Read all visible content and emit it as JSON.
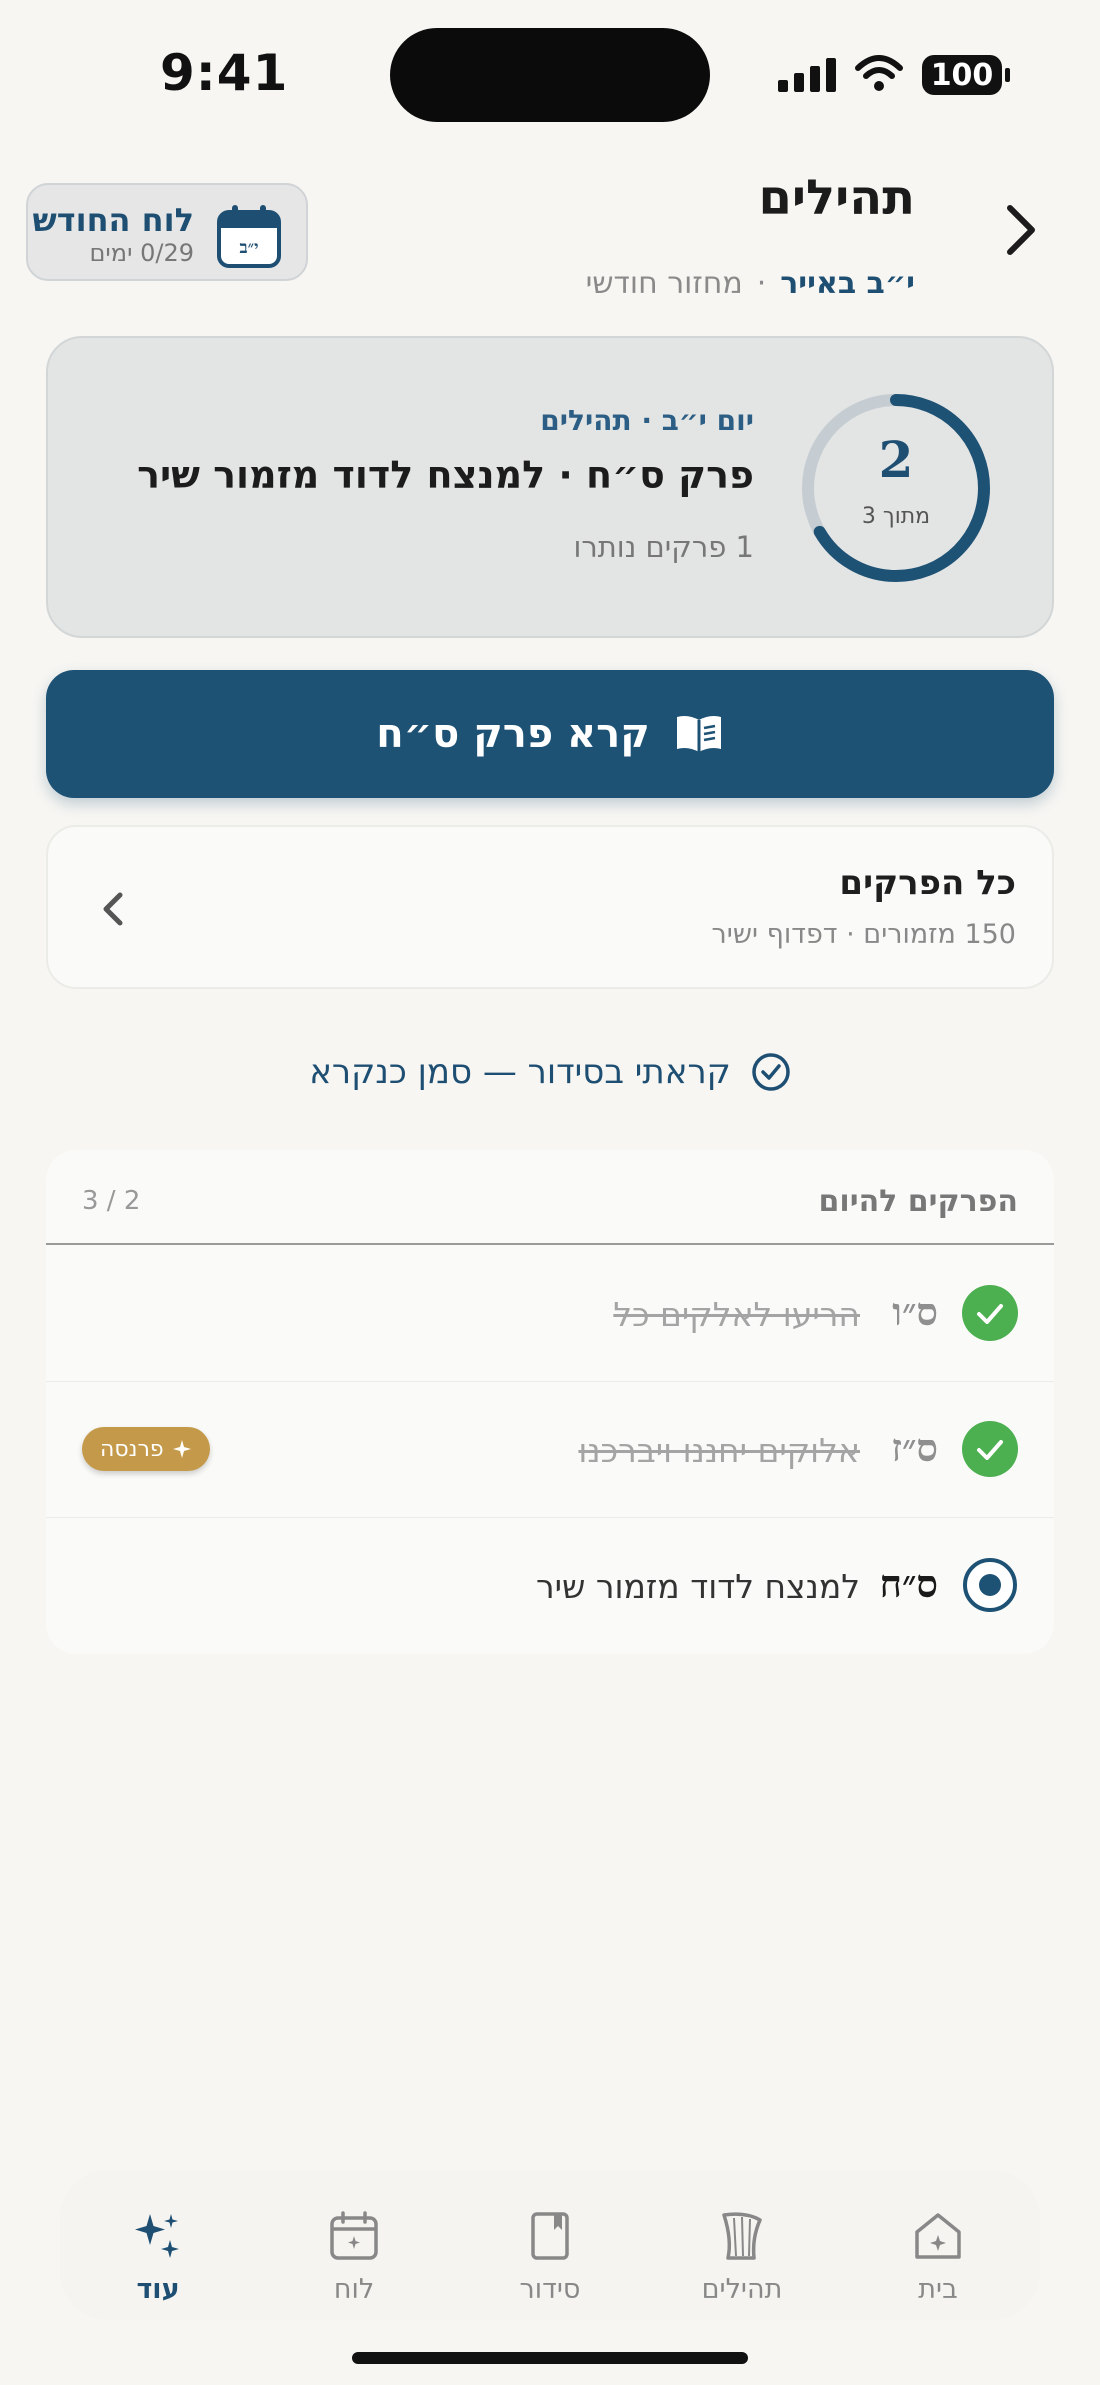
{
  "status": {
    "time": "9:41",
    "battery": "100"
  },
  "header": {
    "title": "תהילים",
    "date": "י״ב באייר",
    "separator": "·",
    "cycle": "מחזור חודשי"
  },
  "month_button": {
    "label": "לוח החודש",
    "days": "0/29 ימים",
    "calendar_badge": "י״ב"
  },
  "progress": {
    "current": "2",
    "of_label": "מתוך 3",
    "completed": 2,
    "total": 3,
    "eyebrow": "יום י״ב · תהילים",
    "title": "פרק ס״ח · למנצח לדוד מזמור שיר",
    "remaining": "1 פרקים נותרו"
  },
  "read_button": {
    "label": "קרא פרק ס״ח"
  },
  "all_chapters": {
    "title": "כל הפרקים",
    "subtitle": "150 מזמורים · דפדוף ישיר"
  },
  "mark_read": {
    "label": "קראתי בסידור — סמן כנקרא"
  },
  "today": {
    "header": "הפרקים להיום",
    "count": "3 / 2",
    "rows": [
      {
        "num": "ס״ו",
        "name": "הריעו לאלקים כל",
        "state": "done"
      },
      {
        "num": "ס״ז",
        "name": "אלוקים יחננו ויברכנו",
        "state": "done",
        "badge": "פרנסה"
      },
      {
        "num": "ס״ח",
        "name": "למנצח לדוד מזמור שיר",
        "state": "current"
      }
    ]
  },
  "tabs": [
    {
      "label": "בית",
      "icon": "home-icon"
    },
    {
      "label": "תהילים",
      "icon": "harp-icon"
    },
    {
      "label": "סידור",
      "icon": "book-icon"
    },
    {
      "label": "לוח",
      "icon": "calendar-icon"
    },
    {
      "label": "עוד",
      "icon": "sparkles-icon",
      "active": true
    }
  ],
  "colors": {
    "accent": "#1e5275",
    "success": "#4caf50",
    "badge": "#c49a4a",
    "background": "#f7f6f3"
  }
}
